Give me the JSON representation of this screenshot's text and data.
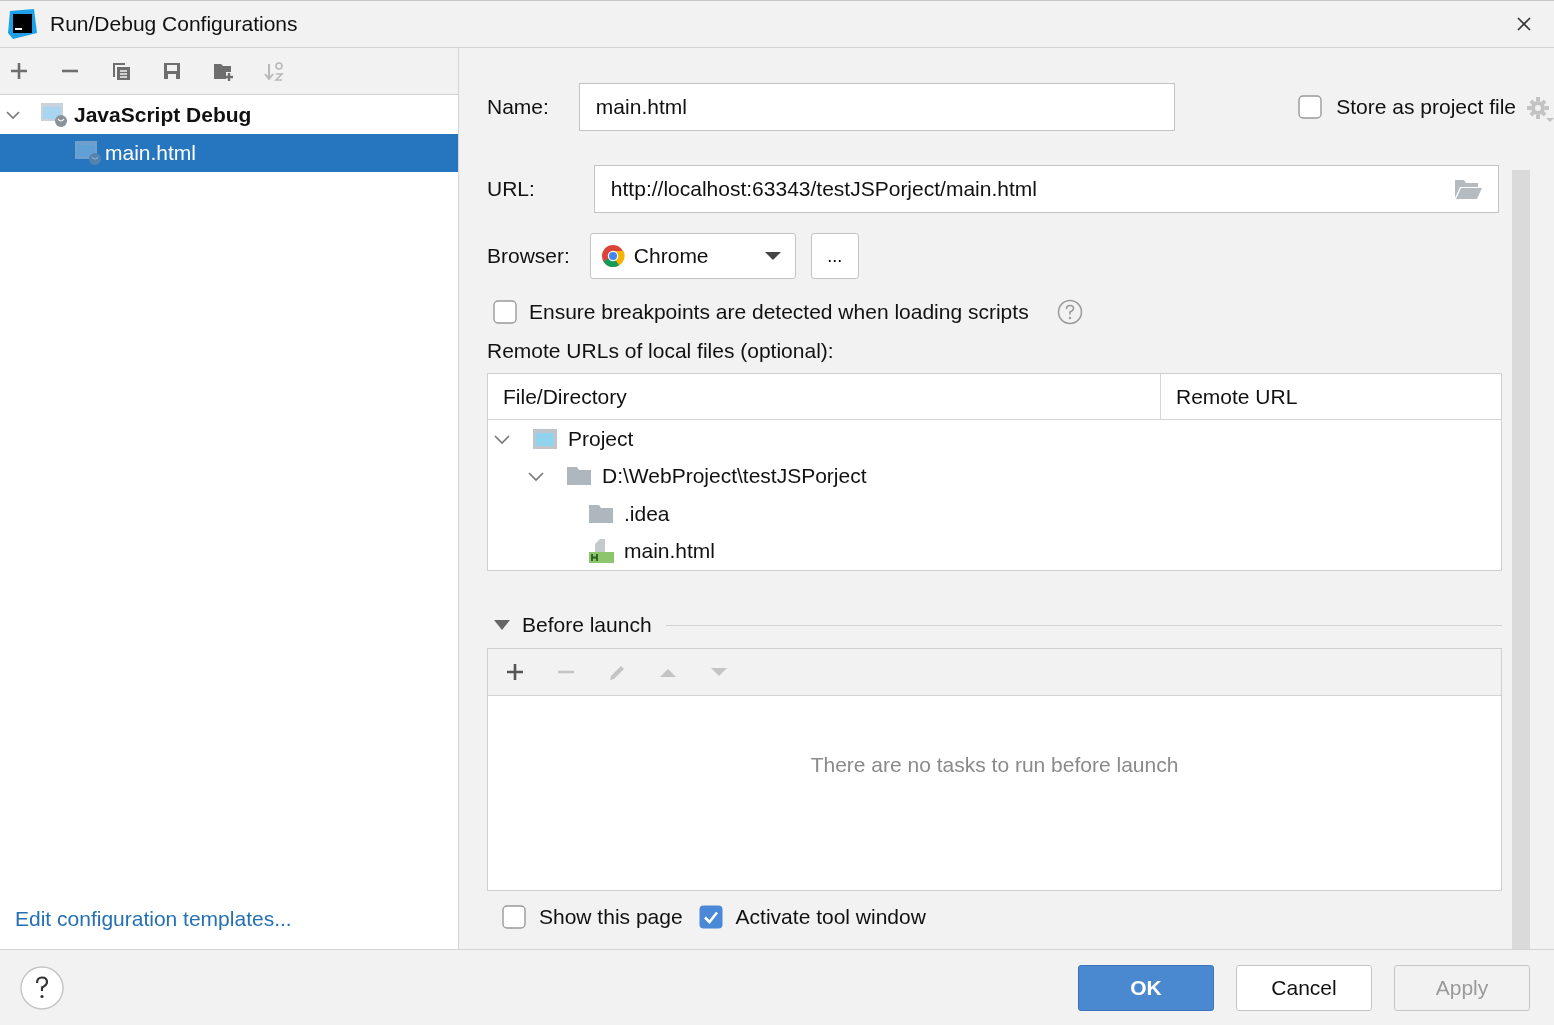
{
  "window": {
    "title": "Run/Debug Configurations"
  },
  "toolbar": [
    {
      "kind": "add",
      "disabled": false
    },
    {
      "kind": "remove",
      "disabled": false
    },
    {
      "kind": "copy",
      "disabled": false
    },
    {
      "kind": "save",
      "disabled": false
    },
    {
      "kind": "folder",
      "disabled": false
    },
    {
      "kind": "sort",
      "disabled": true
    }
  ],
  "config_tree": [
    {
      "label": "JavaScript Debug",
      "expanded": true,
      "selected": false,
      "children": [
        {
          "label": "main.html",
          "selected": true
        }
      ]
    }
  ],
  "templates_link": "Edit configuration templates...",
  "form": {
    "name_label": "Name:",
    "name_value": "main.html",
    "store_label": "Store as project file",
    "store_checked": false,
    "url_label": "URL:",
    "url_value": "http://localhost:63343/testJSPorject/main.html",
    "browser_label": "Browser:",
    "browser_value": "Chrome",
    "browse_button": "...",
    "ensure_label": "Ensure breakpoints are detected when loading scripts",
    "ensure_checked": false,
    "remote_label": "Remote URLs of local files (optional):"
  },
  "mapping_table": {
    "columns": [
      "File/Directory",
      "Remote URL"
    ],
    "rows": [
      {
        "name": "Project",
        "kind": "project",
        "expanded": true,
        "children": [
          {
            "name": "D:\\WebProject\\testJSPorject",
            "kind": "folder",
            "expanded": true,
            "children": [
              {
                "name": ".idea",
                "kind": "folder"
              },
              {
                "name": "main.html",
                "kind": "html"
              }
            ]
          }
        ]
      }
    ]
  },
  "before_launch": {
    "title": "Before launch",
    "expanded": true,
    "tools": [
      {
        "kind": "add",
        "disabled": false
      },
      {
        "kind": "remove",
        "disabled": true
      },
      {
        "kind": "edit",
        "disabled": true
      },
      {
        "kind": "up",
        "disabled": true
      },
      {
        "kind": "down",
        "disabled": true
      }
    ],
    "empty_text": "There are no tasks to run before launch",
    "show_page_label": "Show this page",
    "show_page_checked": false,
    "activate_label": "Activate tool window",
    "activate_checked": true
  },
  "buttons": [
    {
      "label": "OK",
      "kind": "primary",
      "disabled": false
    },
    {
      "label": "Cancel",
      "kind": "normal",
      "disabled": false
    },
    {
      "label": "Apply",
      "kind": "normal",
      "disabled": true
    }
  ]
}
